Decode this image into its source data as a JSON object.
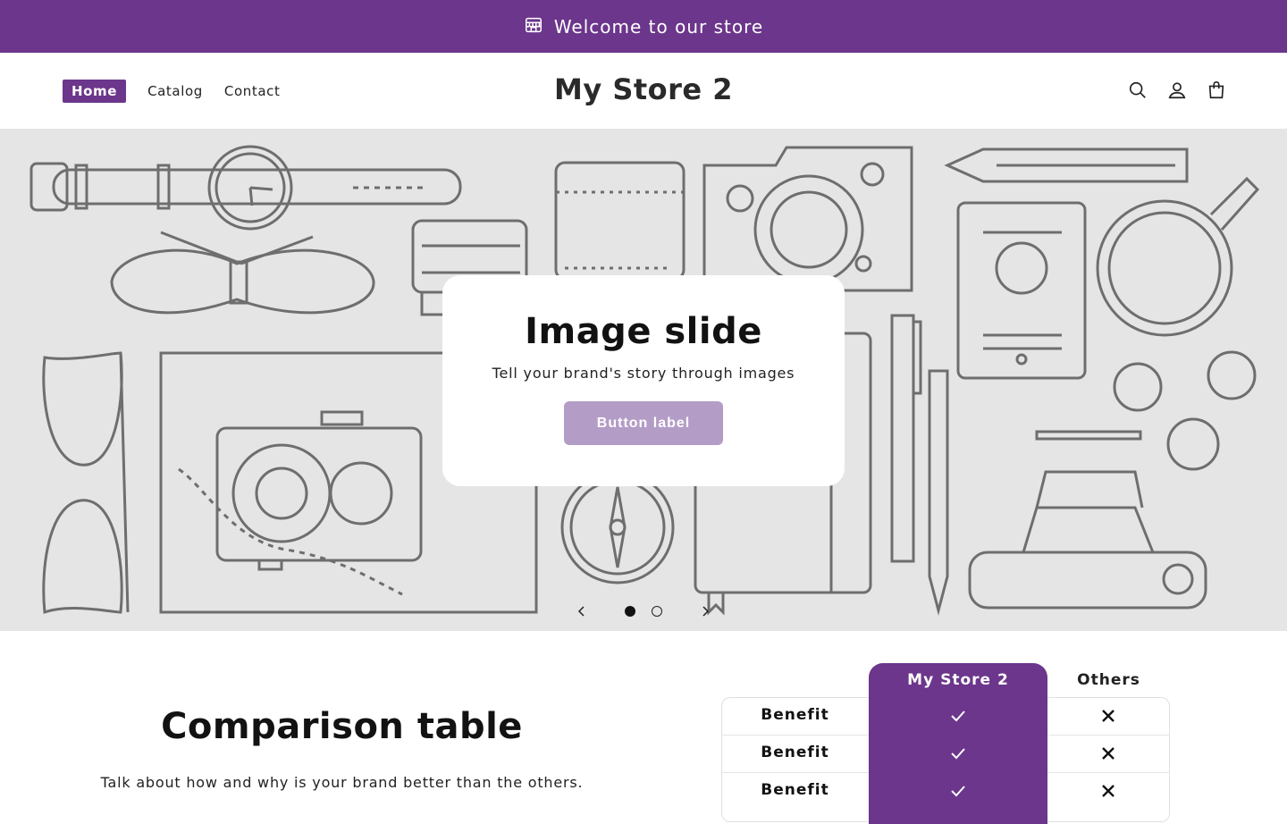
{
  "announcement": {
    "text": "Welcome to our store",
    "icon": "store-icon"
  },
  "header": {
    "logo": "My Store 2",
    "nav": [
      {
        "label": "Home",
        "active": true
      },
      {
        "label": "Catalog",
        "active": false
      },
      {
        "label": "Contact",
        "active": false
      }
    ],
    "icons": [
      "search-icon",
      "account-icon",
      "cart-icon"
    ]
  },
  "hero": {
    "title": "Image slide",
    "subtitle": "Tell your brand's story through images",
    "button_label": "Button label",
    "slide_count": 2,
    "active_slide": 1
  },
  "comparison": {
    "title": "Comparison table",
    "subtitle": "Talk about how and why is your brand better than the others.",
    "col_ours": "My Store 2",
    "col_others": "Others",
    "rows": [
      {
        "label": "Benefit",
        "ours": "check-icon",
        "others": "cross-icon"
      },
      {
        "label": "Benefit",
        "ours": "check-icon",
        "others": "cross-icon"
      },
      {
        "label": "Benefit",
        "ours": "check-icon",
        "others": "cross-icon"
      }
    ]
  },
  "colors": {
    "brand": "#6b368b",
    "button": "#b39cc6",
    "hero_bg": "#e5e5e5",
    "line_art": "#6e6e6e"
  }
}
